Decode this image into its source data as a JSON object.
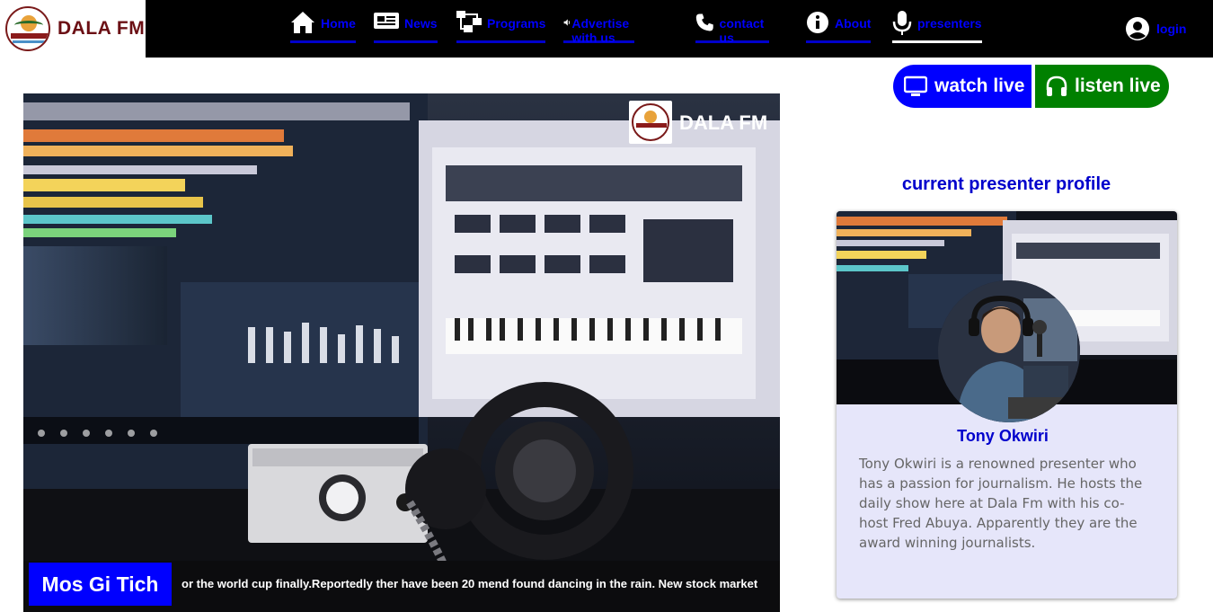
{
  "brand": {
    "name": "DALA FM",
    "logo_icon": "dala-fm-logo"
  },
  "nav": {
    "items": [
      {
        "label": "Home",
        "icon": "home-icon"
      },
      {
        "label": "News",
        "icon": "newspaper-icon"
      },
      {
        "label": "Programs",
        "icon": "sitemap-icon"
      },
      {
        "label": "Advertise with us",
        "icon": "speaker-icon"
      },
      {
        "label": "contact us",
        "icon": "phone-icon"
      },
      {
        "label": "About",
        "icon": "info-icon"
      },
      {
        "label": "presenters",
        "icon": "microphone-icon",
        "active": true
      }
    ],
    "login_label": "login"
  },
  "actions": {
    "watch_label": "watch live",
    "listen_label": "listen live"
  },
  "hero": {
    "brand": "DALA FM",
    "ticker_label": "Mos Gi Tich",
    "ticker_text": "or the world cup finally.Reportedly ther have been 20 mend found dancing in the rain. New stock market"
  },
  "profile": {
    "heading": "current presenter profile",
    "name": "Tony Okwiri",
    "bio": "Tony Okwiri is a renowned presenter who has a passion for journalism. He hosts the daily show here at Dala Fm with his co-host Fred Abuya. Apparently they are the award winning journalists."
  },
  "colors": {
    "nav_bg": "#000000",
    "link": "#0000ff",
    "watch_button": "#0000ff",
    "listen_button": "#008000",
    "card_bg": "#e6e6fa",
    "brand_text": "#6b0f14"
  }
}
